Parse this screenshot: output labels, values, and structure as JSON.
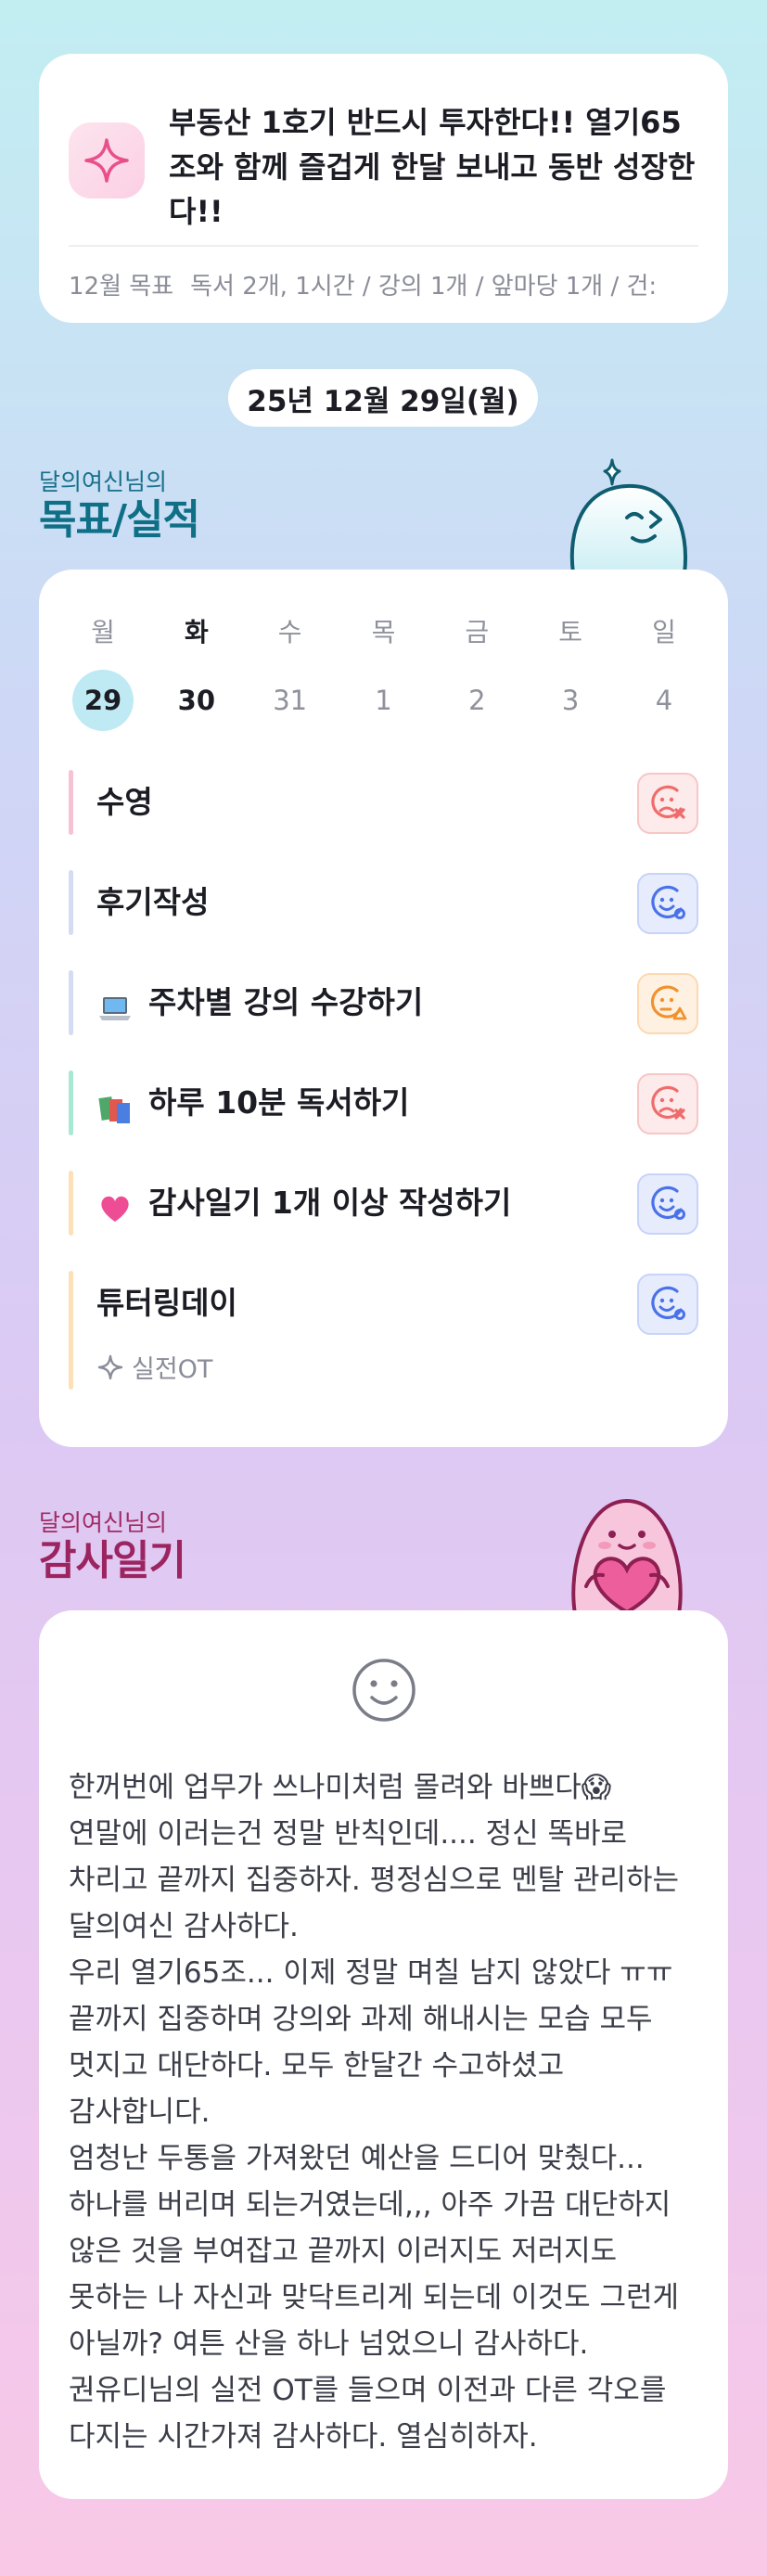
{
  "goal": {
    "title": "부동산 1호기 반드시 투자한다!! 열기65조와 함께 즐겁게 한달 보내고 동반 성장한다!!",
    "month_label": "12월 목표",
    "month_goals": "독서 2개, 1시간 / 강의 1개 / 앞마당 1개 / 건:"
  },
  "date": "25년 12월 29일(월)",
  "goals_section": {
    "subtitle": "달의여신님의",
    "title": "목표/실적"
  },
  "week": [
    {
      "day": "월",
      "date": "29"
    },
    {
      "day": "화",
      "date": "30"
    },
    {
      "day": "수",
      "date": "31"
    },
    {
      "day": "목",
      "date": "1"
    },
    {
      "day": "금",
      "date": "2"
    },
    {
      "day": "토",
      "date": "3"
    },
    {
      "day": "일",
      "date": "4"
    }
  ],
  "tasks": [
    {
      "label": "수영",
      "emoji": "",
      "bar_color": "#f7c2d6",
      "status": "sad-x"
    },
    {
      "label": "후기작성",
      "emoji": "",
      "bar_color": "#d4dcf4",
      "status": "happy"
    },
    {
      "label": "주차별 강의 수강하기",
      "emoji": "laptop-icon",
      "bar_color": "#d4dcf4",
      "status": "neutral-warning"
    },
    {
      "label": "하루 10분 독서하기",
      "emoji": "books-icon",
      "bar_color": "#a8e8d4",
      "status": "sad-x"
    },
    {
      "label": "감사일기 1개 이상 작성하기",
      "emoji": "heart-icon",
      "bar_color": "#fde0b8",
      "status": "happy"
    },
    {
      "label": "튜터링데이",
      "emoji": "",
      "bar_color": "#fde0b8",
      "status": "happy",
      "sub": "실전OT"
    }
  ],
  "diary_section": {
    "subtitle": "달의여신님의",
    "title": "감사일기"
  },
  "diary": {
    "text": "한꺼번에 업무가 쓰나미처럼 몰려와 바쁘다😱 연말에 이러는건 정말 반칙인데.... 정신 똑바로 차리고 끝까지 집중하자. 평정심으로 멘탈 관리하는 달의여신 감사하다.\n우리 열기65조... 이제 정말 며칠 남지 않았다 ㅠㅠ 끝까지 집중하며 강의와 과제 해내시는 모습 모두 멋지고 대단하다. 모두 한달간 수고하셨고 감사합니다.\n엄청난 두통을 가져왔던 예산을 드디어 맞췄다... 하나를 버리며 되는거였는데,,, 아주 가끔 대단하지 않은 것을 부여잡고 끝까지 이러지도 저러지도 못하는 나 자신과 맞닥트리게 되는데 이것도 그런게 아닐까? 여튼 산을 하나 넘었으니 감사하다.\n권유디님의 실전 OT를 들으며 이전과 다른 각오를 다지는 시간가져 감사하다. 열심히하자."
  },
  "colors": {
    "accent_teal": "#0e6f86",
    "accent_pink": "#9c2460",
    "selected_day": "#bfeaf3"
  }
}
